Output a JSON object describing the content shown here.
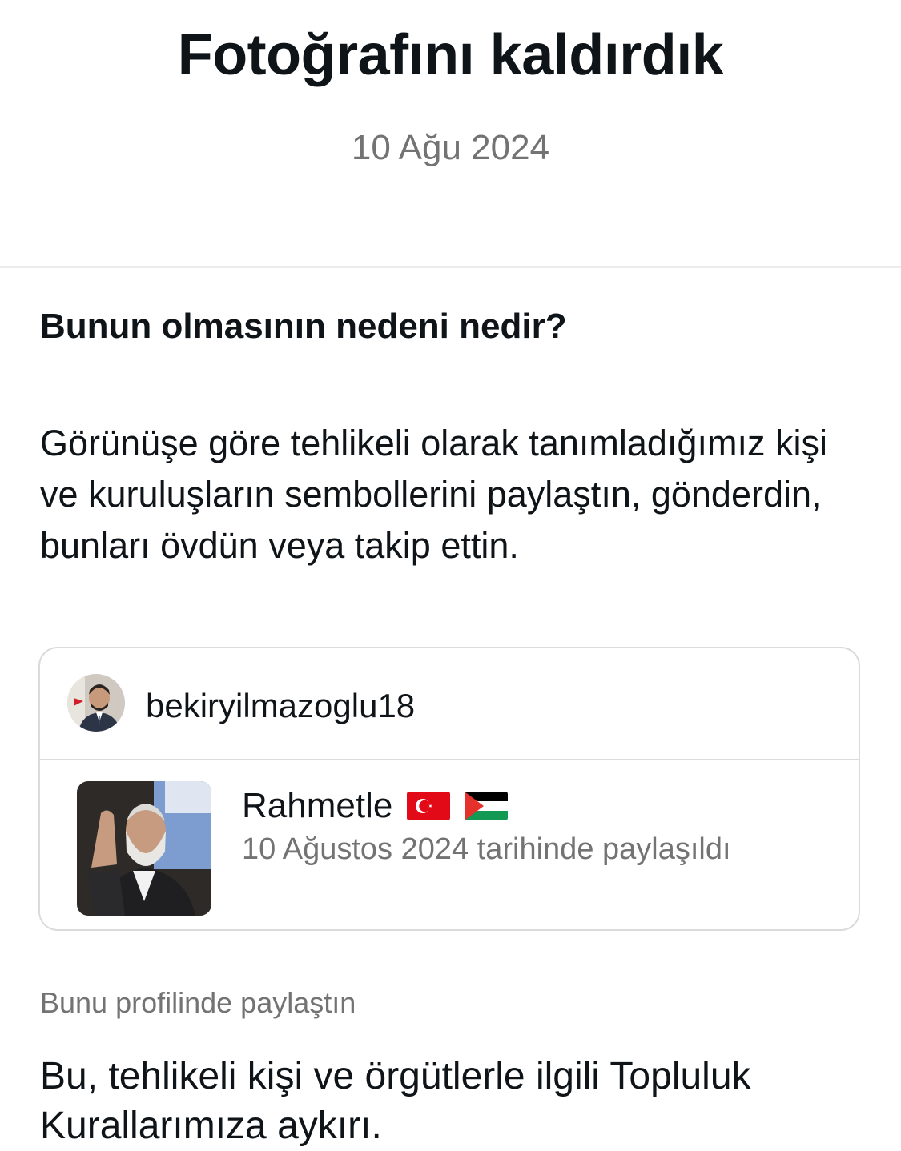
{
  "header": {
    "title": "Fotoğrafını kaldırdık",
    "date": "10 Ağu 2024"
  },
  "reason": {
    "heading": "Bunun olmasının nedeni nedir?",
    "text": "Görünüşe göre tehlikeli olarak tanımladığımız kişi ve kuruluşların sembollerini paylaştın, gönderdin, bunları övdün veya takip ettin."
  },
  "post_card": {
    "username": "bekiryilmazoglu18",
    "caption": "Rahmetle",
    "caption_flags": [
      "turkey-flag-icon",
      "palestine-flag-icon"
    ],
    "shared_date": "10 Ağustos 2024 tarihinde paylaşıldı"
  },
  "shared_note": "Bunu profilinde paylaştın",
  "violation_text": "Bu, tehlikeli kişi ve örgütlerle ilgili Topluluk Kurallarımıza aykırı."
}
